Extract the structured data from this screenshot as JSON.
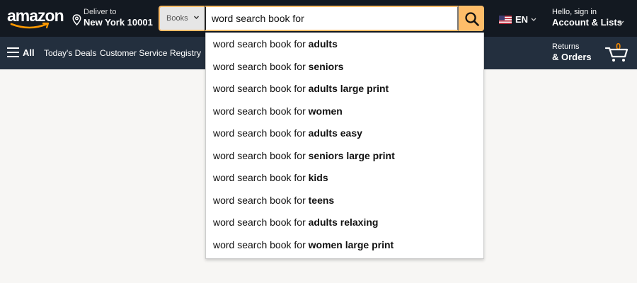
{
  "header": {
    "logo_text": "amazon",
    "deliver_line1": "Deliver to",
    "deliver_line2": "New York 10001",
    "search": {
      "category": "Books",
      "query": "word search book for"
    },
    "language": "EN",
    "account_line1": "Hello, sign in",
    "account_line2": "Account & Lists"
  },
  "subnav": {
    "all_label": "All",
    "links": [
      "Today's Deals",
      "Customer Service",
      "Registry"
    ],
    "returns_line1": "Returns",
    "returns_line2": "& Orders",
    "cart_count": "0"
  },
  "suggestions": {
    "prefix": "word search book for ",
    "items": [
      "adults",
      "seniors",
      "adults large print",
      "women",
      "adults easy",
      "seniors large print",
      "kids",
      "teens",
      "adults relaxing",
      "women large print"
    ]
  },
  "colors": {
    "nav_dark": "#131921",
    "nav_sub": "#232f3e",
    "search_accent": "#febd69",
    "cart_accent": "#f08804"
  },
  "icons": [
    "location-pin-icon",
    "chevron-down-icon",
    "search-icon",
    "us-flag-icon",
    "hamburger-icon",
    "cart-icon"
  ]
}
